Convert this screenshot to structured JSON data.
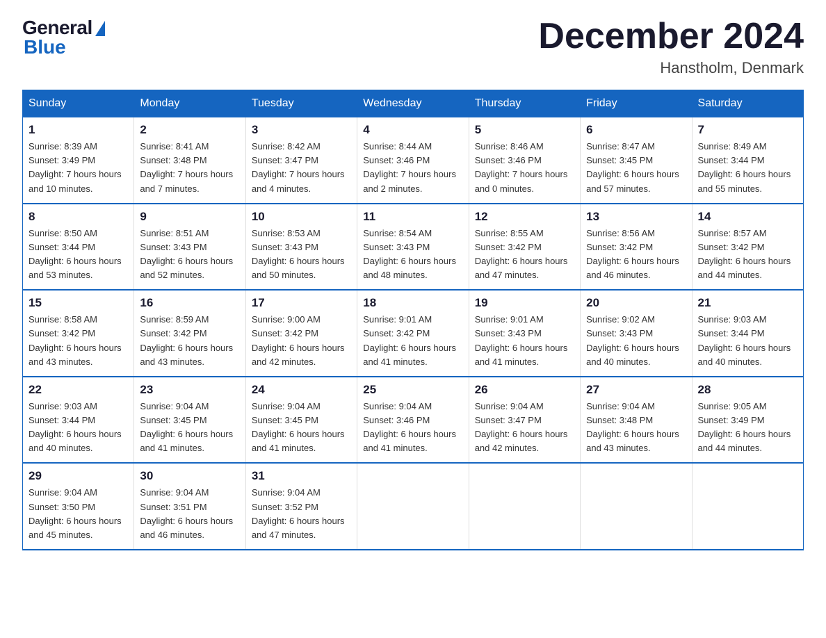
{
  "logo": {
    "general": "General",
    "blue": "Blue"
  },
  "title": "December 2024",
  "location": "Hanstholm, Denmark",
  "days_of_week": [
    "Sunday",
    "Monday",
    "Tuesday",
    "Wednesday",
    "Thursday",
    "Friday",
    "Saturday"
  ],
  "weeks": [
    [
      {
        "day": "1",
        "sunrise": "8:39 AM",
        "sunset": "3:49 PM",
        "daylight": "7 hours and 10 minutes."
      },
      {
        "day": "2",
        "sunrise": "8:41 AM",
        "sunset": "3:48 PM",
        "daylight": "7 hours and 7 minutes."
      },
      {
        "day": "3",
        "sunrise": "8:42 AM",
        "sunset": "3:47 PM",
        "daylight": "7 hours and 4 minutes."
      },
      {
        "day": "4",
        "sunrise": "8:44 AM",
        "sunset": "3:46 PM",
        "daylight": "7 hours and 2 minutes."
      },
      {
        "day": "5",
        "sunrise": "8:46 AM",
        "sunset": "3:46 PM",
        "daylight": "7 hours and 0 minutes."
      },
      {
        "day": "6",
        "sunrise": "8:47 AM",
        "sunset": "3:45 PM",
        "daylight": "6 hours and 57 minutes."
      },
      {
        "day": "7",
        "sunrise": "8:49 AM",
        "sunset": "3:44 PM",
        "daylight": "6 hours and 55 minutes."
      }
    ],
    [
      {
        "day": "8",
        "sunrise": "8:50 AM",
        "sunset": "3:44 PM",
        "daylight": "6 hours and 53 minutes."
      },
      {
        "day": "9",
        "sunrise": "8:51 AM",
        "sunset": "3:43 PM",
        "daylight": "6 hours and 52 minutes."
      },
      {
        "day": "10",
        "sunrise": "8:53 AM",
        "sunset": "3:43 PM",
        "daylight": "6 hours and 50 minutes."
      },
      {
        "day": "11",
        "sunrise": "8:54 AM",
        "sunset": "3:43 PM",
        "daylight": "6 hours and 48 minutes."
      },
      {
        "day": "12",
        "sunrise": "8:55 AM",
        "sunset": "3:42 PM",
        "daylight": "6 hours and 47 minutes."
      },
      {
        "day": "13",
        "sunrise": "8:56 AM",
        "sunset": "3:42 PM",
        "daylight": "6 hours and 46 minutes."
      },
      {
        "day": "14",
        "sunrise": "8:57 AM",
        "sunset": "3:42 PM",
        "daylight": "6 hours and 44 minutes."
      }
    ],
    [
      {
        "day": "15",
        "sunrise": "8:58 AM",
        "sunset": "3:42 PM",
        "daylight": "6 hours and 43 minutes."
      },
      {
        "day": "16",
        "sunrise": "8:59 AM",
        "sunset": "3:42 PM",
        "daylight": "6 hours and 43 minutes."
      },
      {
        "day": "17",
        "sunrise": "9:00 AM",
        "sunset": "3:42 PM",
        "daylight": "6 hours and 42 minutes."
      },
      {
        "day": "18",
        "sunrise": "9:01 AM",
        "sunset": "3:42 PM",
        "daylight": "6 hours and 41 minutes."
      },
      {
        "day": "19",
        "sunrise": "9:01 AM",
        "sunset": "3:43 PM",
        "daylight": "6 hours and 41 minutes."
      },
      {
        "day": "20",
        "sunrise": "9:02 AM",
        "sunset": "3:43 PM",
        "daylight": "6 hours and 40 minutes."
      },
      {
        "day": "21",
        "sunrise": "9:03 AM",
        "sunset": "3:44 PM",
        "daylight": "6 hours and 40 minutes."
      }
    ],
    [
      {
        "day": "22",
        "sunrise": "9:03 AM",
        "sunset": "3:44 PM",
        "daylight": "6 hours and 40 minutes."
      },
      {
        "day": "23",
        "sunrise": "9:04 AM",
        "sunset": "3:45 PM",
        "daylight": "6 hours and 41 minutes."
      },
      {
        "day": "24",
        "sunrise": "9:04 AM",
        "sunset": "3:45 PM",
        "daylight": "6 hours and 41 minutes."
      },
      {
        "day": "25",
        "sunrise": "9:04 AM",
        "sunset": "3:46 PM",
        "daylight": "6 hours and 41 minutes."
      },
      {
        "day": "26",
        "sunrise": "9:04 AM",
        "sunset": "3:47 PM",
        "daylight": "6 hours and 42 minutes."
      },
      {
        "day": "27",
        "sunrise": "9:04 AM",
        "sunset": "3:48 PM",
        "daylight": "6 hours and 43 minutes."
      },
      {
        "day": "28",
        "sunrise": "9:05 AM",
        "sunset": "3:49 PM",
        "daylight": "6 hours and 44 minutes."
      }
    ],
    [
      {
        "day": "29",
        "sunrise": "9:04 AM",
        "sunset": "3:50 PM",
        "daylight": "6 hours and 45 minutes."
      },
      {
        "day": "30",
        "sunrise": "9:04 AM",
        "sunset": "3:51 PM",
        "daylight": "6 hours and 46 minutes."
      },
      {
        "day": "31",
        "sunrise": "9:04 AM",
        "sunset": "3:52 PM",
        "daylight": "6 hours and 47 minutes."
      },
      null,
      null,
      null,
      null
    ]
  ],
  "labels": {
    "sunrise": "Sunrise:",
    "sunset": "Sunset:",
    "daylight": "Daylight:"
  }
}
